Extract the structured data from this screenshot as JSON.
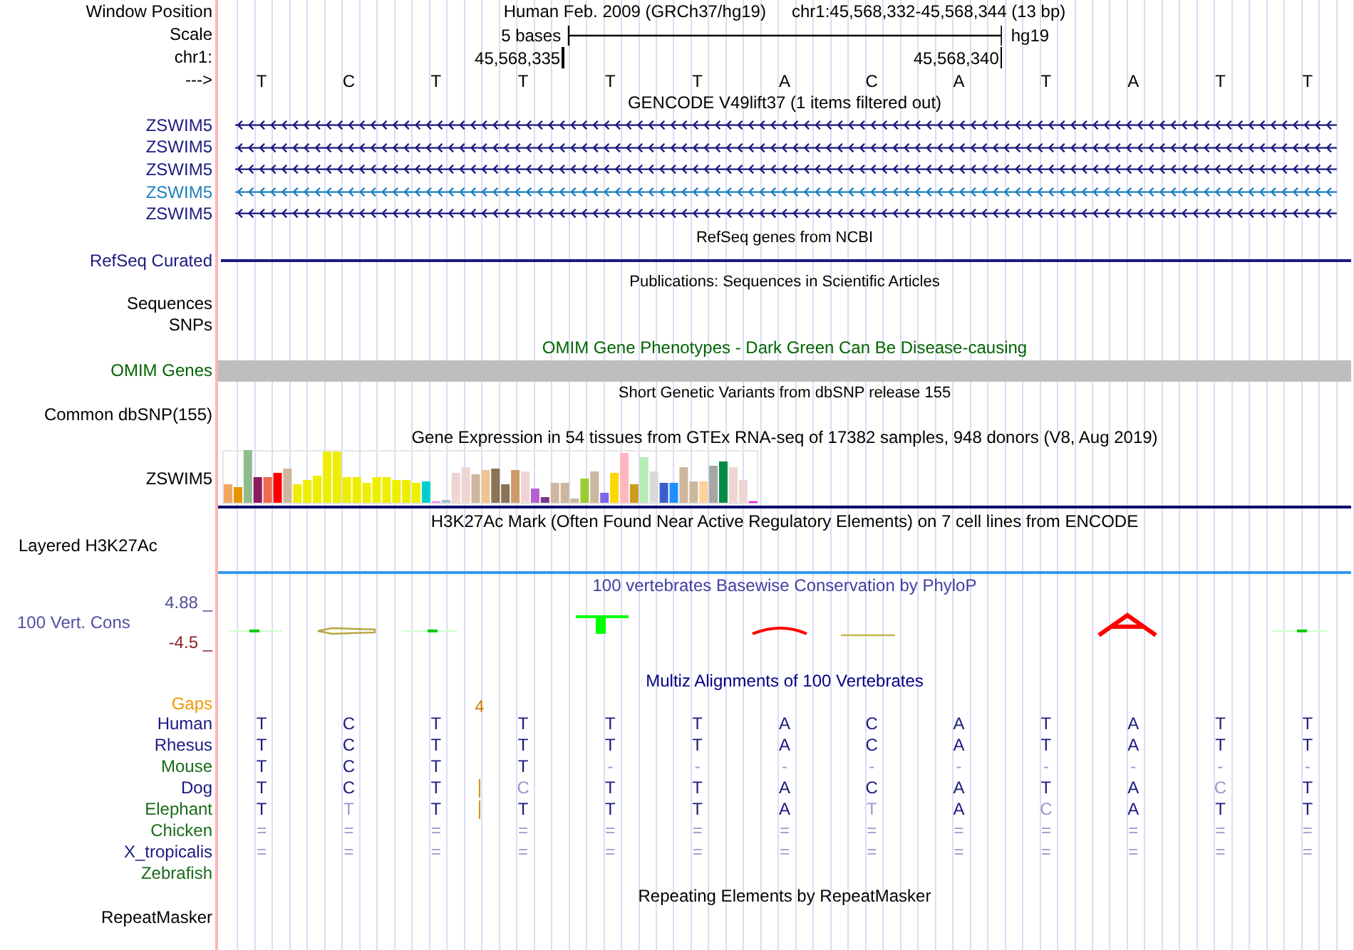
{
  "header": {
    "window_position_label": "Window Position",
    "scale_label": "Scale",
    "chrom_label": "chr1:",
    "strand_label": "--->",
    "assembly": "Human Feb. 2009 (GRCh37/hg19)",
    "position": "chr1:45,568,332-45,568,344 (13 bp)",
    "scale_text": "5 bases",
    "scale_assembly": "hg19",
    "ruler_start": "45,568,335",
    "ruler_end": "45,568,340",
    "bases": [
      "T",
      "C",
      "T",
      "T",
      "T",
      "T",
      "A",
      "C",
      "A",
      "T",
      "A",
      "T",
      "T"
    ]
  },
  "gencode": {
    "title": "GENCODE V49lift37 (1 items filtered out)",
    "items": [
      {
        "label": "ZSWIM5",
        "color": "#1a1a80"
      },
      {
        "label": "ZSWIM5",
        "color": "#1a1a80"
      },
      {
        "label": "ZSWIM5",
        "color": "#1a1a80"
      },
      {
        "label": "ZSWIM5",
        "color": "#1f7fbf"
      },
      {
        "label": "ZSWIM5",
        "color": "#1a1a80"
      }
    ]
  },
  "refseq": {
    "title": "RefSeq genes from NCBI",
    "label": "RefSeq Curated"
  },
  "publications": {
    "title": "Publications: Sequences in Scientific Articles",
    "labels": [
      "Sequences",
      "SNPs"
    ]
  },
  "omim": {
    "title": "OMIM Gene Phenotypes - Dark Green Can Be Disease-causing",
    "label": "OMIM Genes"
  },
  "dbsnp": {
    "title": "Short Genetic Variants from dbSNP release 155",
    "label": "Common dbSNP(155)"
  },
  "gtex": {
    "title": "Gene Expression in 54 tissues from GTEx RNA-seq of 17382 samples, 948 donors (V8, Aug 2019)",
    "label": "ZSWIM5"
  },
  "h3k27ac": {
    "title": "H3K27Ac Mark (Often Found Near Active Regulatory Elements) on 7 cell lines from ENCODE",
    "label": "Layered H3K27Ac"
  },
  "phylop": {
    "title": "100 vertebrates Basewise Conservation by PhyloP",
    "label": "100 Vert. Cons",
    "max": "4.88 _",
    "min": "-4.5 _"
  },
  "multiz": {
    "title": "Multiz Alignments of 100 Vertebrates",
    "gaps_label": "Gaps",
    "gap_mark": "4",
    "species": [
      {
        "name": "Human",
        "color": "#1a1a80",
        "insertion": false,
        "bases": [
          "T",
          "C",
          "T",
          "T",
          "T",
          "T",
          "A",
          "C",
          "A",
          "T",
          "A",
          "T",
          "T"
        ]
      },
      {
        "name": "Rhesus",
        "color": "#1a1a80",
        "insertion": false,
        "bases": [
          "T",
          "C",
          "T",
          "T",
          "T",
          "T",
          "A",
          "C",
          "A",
          "T",
          "A",
          "T",
          "T"
        ]
      },
      {
        "name": "Mouse",
        "color": "#1a6b1a",
        "insertion": false,
        "bases": [
          "T",
          "C",
          "T",
          "T",
          "-",
          "-",
          "-",
          "-",
          "-",
          "-",
          "-",
          "-",
          "-"
        ]
      },
      {
        "name": "Dog",
        "color": "#1a1a80",
        "insertion": true,
        "bases": [
          "T",
          "C",
          "T",
          "C",
          "T",
          "T",
          "A",
          "C",
          "A",
          "T",
          "A",
          "C",
          "T"
        ]
      },
      {
        "name": "Elephant",
        "color": "#1a6b1a",
        "insertion": true,
        "bases": [
          "T",
          "T",
          "T",
          "T",
          "T",
          "T",
          "A",
          "T",
          "A",
          "C",
          "A",
          "T",
          "T"
        ]
      },
      {
        "name": "Chicken",
        "color": "#1a6b1a",
        "insertion": false,
        "bases": [
          "=",
          "=",
          "=",
          "=",
          "=",
          "=",
          "=",
          "=",
          "=",
          "=",
          "=",
          "=",
          "="
        ]
      },
      {
        "name": "X_tropicalis",
        "color": "#1a1a80",
        "insertion": false,
        "bases": [
          "=",
          "=",
          "=",
          "=",
          "=",
          "=",
          "=",
          "=",
          "=",
          "=",
          "=",
          "=",
          "="
        ]
      },
      {
        "name": "Zebrafish",
        "color": "#1a6b1a",
        "insertion": false
      }
    ]
  },
  "repeatmasker": {
    "title": "Repeating Elements by RepeatMasker",
    "label": "RepeatMasker"
  }
}
